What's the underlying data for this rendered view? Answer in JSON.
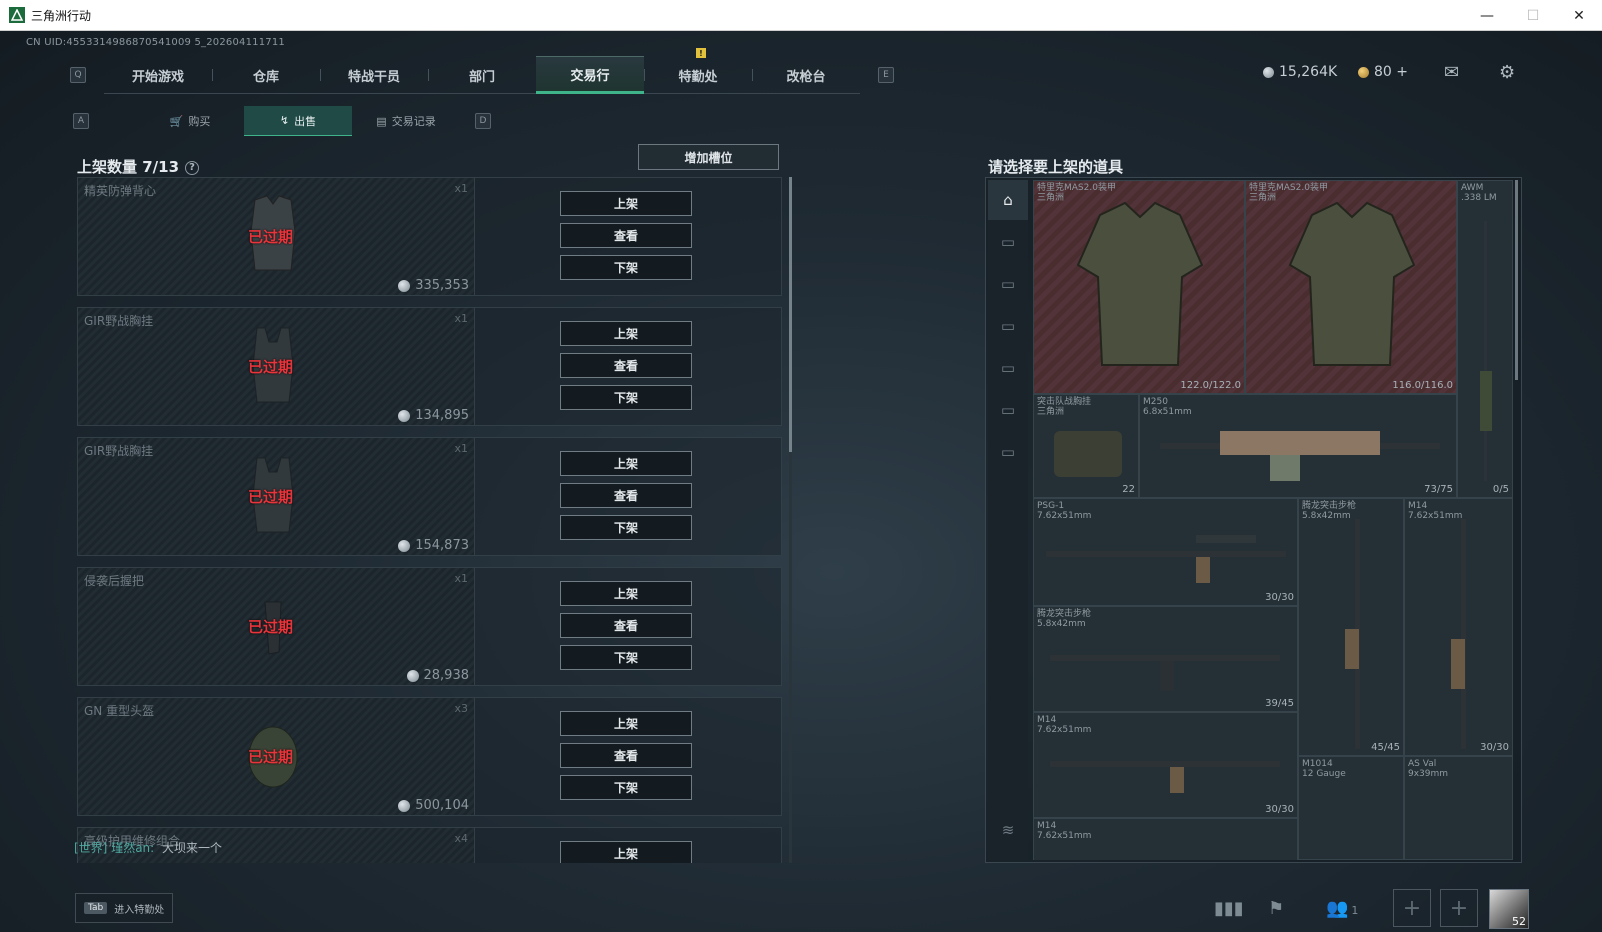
{
  "window": {
    "title": "三角洲行动",
    "min": "—",
    "max": "☐",
    "close": "✕"
  },
  "uid": "CN UID:4553314986870541009 5_202604111711",
  "nav": {
    "left_key": "Q",
    "right_key": "E",
    "tabs": [
      "开始游戏",
      "仓库",
      "特战干员",
      "部门",
      "交易行",
      "特勤处",
      "改枪台"
    ],
    "active": "交易行",
    "notice": "!"
  },
  "currency": {
    "silver": "15,264K",
    "gold": "80 +"
  },
  "subnav": {
    "left_key": "A",
    "right_key": "D",
    "tabs": [
      "购买",
      "出售",
      "交易记录"
    ],
    "icons": [
      "🛒",
      "↯",
      "▤"
    ],
    "active": "出售"
  },
  "listing": {
    "title": "上架数量 7/13",
    "help": "?",
    "add_slot": "增加槽位",
    "action_labels": [
      "上架",
      "查看",
      "下架"
    ],
    "items": [
      {
        "name": "精英防弹背心",
        "qty": "x1",
        "status": "已过期",
        "price": "335,353"
      },
      {
        "name": "GIR野战胸挂",
        "qty": "x1",
        "status": "已过期",
        "price": "134,895"
      },
      {
        "name": "GIR野战胸挂",
        "qty": "x1",
        "status": "已过期",
        "price": "154,873"
      },
      {
        "name": "侵袭后握把",
        "qty": "x1",
        "status": "已过期",
        "price": "28,938"
      },
      {
        "name": "GN 重型头盔",
        "qty": "x3",
        "status": "已过期",
        "price": "500,104"
      },
      {
        "name": "高级护甲维修组合",
        "qty": "x4",
        "status": "",
        "price": ""
      }
    ]
  },
  "chat": {
    "channel": "[世界]",
    "user": "瑾然an:",
    "message": "大坝来一个"
  },
  "inventory": {
    "title": "请选择要上架的道具",
    "cells": [
      {
        "name": "特里克MAS2.0装甲",
        "sub": "三角洲",
        "br": "122.0/122.0"
      },
      {
        "name": "特里克MAS2.0装甲",
        "sub": "三角洲",
        "br": "116.0/116.0"
      },
      {
        "name": "AWM",
        "sub": ".338 LM",
        "br": "0/5"
      },
      {
        "name": "突击队战胸挂",
        "sub": "三角洲",
        "br": "22"
      },
      {
        "name": "M250",
        "sub": "6.8x51mm",
        "br": "73/75"
      },
      {
        "name": "PSG-1",
        "sub": "7.62x51mm",
        "br": "30/30"
      },
      {
        "name": "腾龙突击步枪",
        "sub": "5.8x42mm",
        "br": "45/45"
      },
      {
        "name": "M14",
        "sub": "7.62x51mm",
        "br": "30/30"
      },
      {
        "name": "腾龙突击步枪",
        "sub": "5.8x42mm",
        "br": "39/45"
      },
      {
        "name": "M14",
        "sub": "7.62x51mm",
        "br": "30/30"
      },
      {
        "name": "M1014",
        "sub": "12 Gauge",
        "br": ""
      },
      {
        "name": "AS Val",
        "sub": "9x39mm",
        "br": ""
      },
      {
        "name": "M14",
        "sub": "7.62x51mm",
        "br": ""
      }
    ]
  },
  "bottom": {
    "tab_key": "Tab",
    "tab_label": "进入特勤处",
    "squad_count": "1",
    "level": "52"
  },
  "colors": {
    "accent": "#3fb38a",
    "expired": "#e8343a",
    "panel": "#1c252b"
  }
}
